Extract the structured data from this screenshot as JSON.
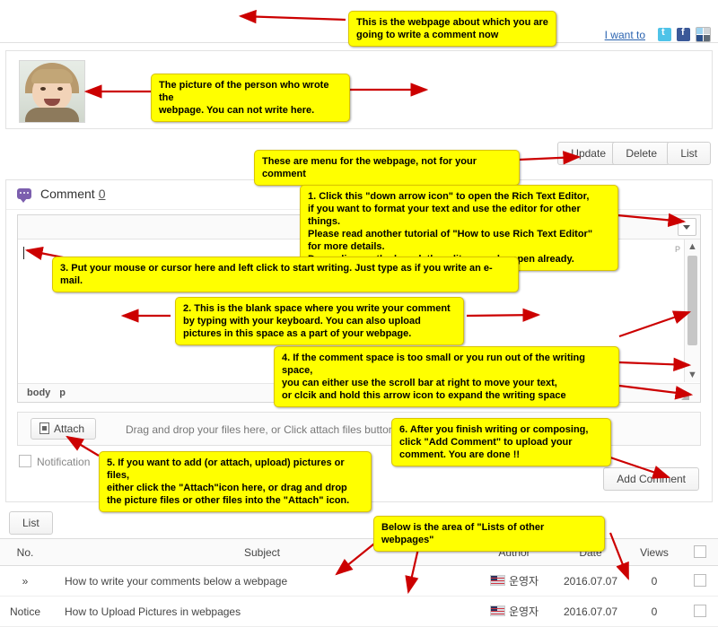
{
  "header": {
    "i_want_to": "I want to",
    "social_icons": [
      "twitter-icon",
      "facebook-icon",
      "more-share-icon"
    ]
  },
  "author_block": {
    "avatar_alt": "author-profile-photo"
  },
  "page_menu": {
    "update": "Update",
    "delete": "Delete",
    "list": "List"
  },
  "comment_section": {
    "title": "Comment",
    "count": "0",
    "editor": {
      "expand_icon": "chevron-down-icon",
      "scroll_up_icon": "chevron-up-icon",
      "scroll_down_icon": "chevron-down-icon",
      "path_tag_1": "body",
      "path_tag_2": "p",
      "paragraph_marker": "P",
      "resize_handle": "resize-grip-icon"
    },
    "attach": {
      "button_label": "Attach",
      "hint": "Drag and drop your files here, or Click attach files button."
    },
    "notification_label": "Notification",
    "add_comment_label": "Add Comment"
  },
  "bottom": {
    "list_button": "List"
  },
  "board_table": {
    "columns": [
      "No.",
      "Subject",
      "Author",
      "Date",
      "Views",
      ""
    ],
    "rows": [
      {
        "no": "»",
        "subject": "How to write your comments below a webpage",
        "author": "운영자",
        "date": "2016.07.07",
        "views": "0"
      },
      {
        "no": "Notice",
        "subject": "How to Upload Pictures in webpages",
        "author": "운영자",
        "date": "2016.07.07",
        "views": "0"
      }
    ]
  },
  "annotations": {
    "a1": "This is the webpage about which you are\ngoing to write a comment now",
    "a2": "The picture of the person who wrote the\nwebpage. You can not write here.",
    "a3": "These are menu for the webpage, not for your comment",
    "a4": "1. Click this \"down arrow icon\" to open the Rich Text Editor,\nif you want to format your text and use the editor for other things.\nPlease read another tutorial of \"How to use Rich Text Editor\"\nfor more details.\nDepending on the board, the editor may be open already.",
    "a5": "3. Put your mouse or cursor here and left click to start writing. Just type as if you write an e-mail.",
    "a6": "2. This is the blank space where you write your comment\nby typing with your keyboard. You can also upload\npictures in this space as a part of your webpage.",
    "a7": "4. If the comment space is too small or you run out of the writing space,\nyou can either use the scroll bar at right to move your text,\nor clcik and hold this arrow icon to expand the writing space",
    "a8": "6. After you finish writing or composing,\nclick \"Add Comment\" to upload your\ncomment. You are done !!",
    "a9": "5. If you want to add (or attach, upload) pictures or files,\neither click the \"Attach\"icon here, or drag and drop\nthe picture files or other files into the \"Attach\" icon.",
    "a10": "Below is the area of \"Lists of other webpages\""
  },
  "colors": {
    "callout_bg": "#ffff00",
    "arrow": "#cc0000",
    "link": "#2a63b0",
    "comment_icon": "#7c5fae"
  }
}
